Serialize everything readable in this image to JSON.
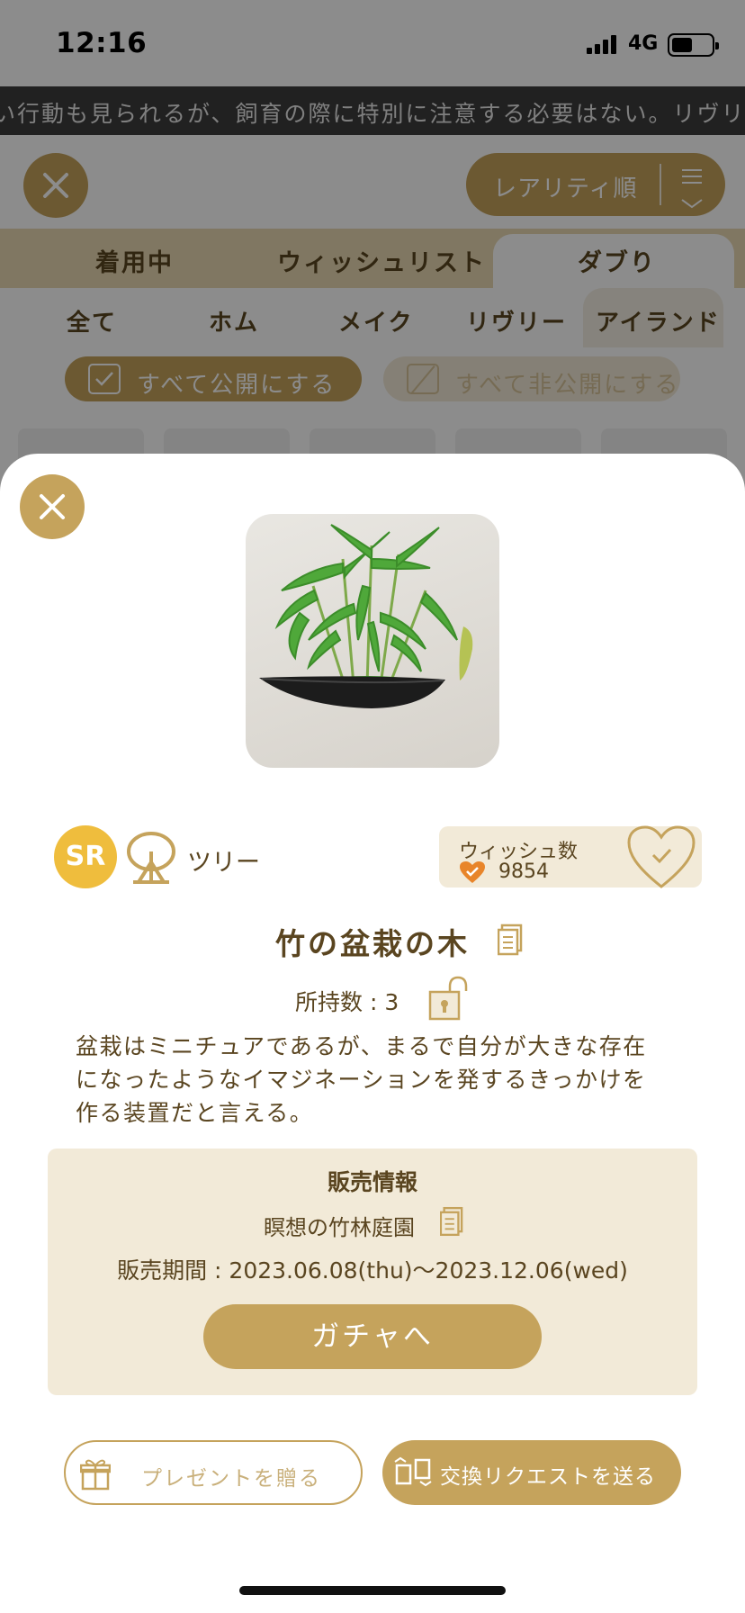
{
  "status_bar": {
    "time": "12:16",
    "network": "4G"
  },
  "ticker": {
    "text": "い行動も見られるが、飼育の際に特別に注意する必要はない。リヴリ"
  },
  "toolbar": {
    "sort_label": "レアリティ順"
  },
  "tabs_primary": [
    "着用中",
    "ウィッシュリスト",
    "ダブり"
  ],
  "tabs_secondary": [
    "全て",
    "ホム",
    "メイク",
    "リヴリー",
    "アイランド"
  ],
  "publish": {
    "all_public": "すべて公開にする",
    "all_private": "すべて非公開にする"
  },
  "item": {
    "rarity": "SR",
    "type": "ツリー",
    "wish_label": "ウィッシュ数",
    "wish_count": "9854",
    "name": "竹の盆栽の木",
    "owned": "所持数 : 3",
    "description": "盆栽はミニチュアであるが、まるで自分が大きな存在になったようなイマジネーションを発するきっかけを作る装置だと言える。"
  },
  "sale": {
    "title": "販売情報",
    "gacha_name": "瞑想の竹林庭園",
    "period": "販売期間 : 2023.06.08(thu)〜2023.12.06(wed)",
    "gacha_button": "ガチャへ"
  },
  "actions": {
    "gift": "プレゼントを贈る",
    "trade": "交換リクエストを送る"
  },
  "colors": {
    "gold": "#c5a35c",
    "cream": "#f2ead8",
    "text_brown": "#5a4520",
    "rarity_yellow": "#efbd3d"
  }
}
